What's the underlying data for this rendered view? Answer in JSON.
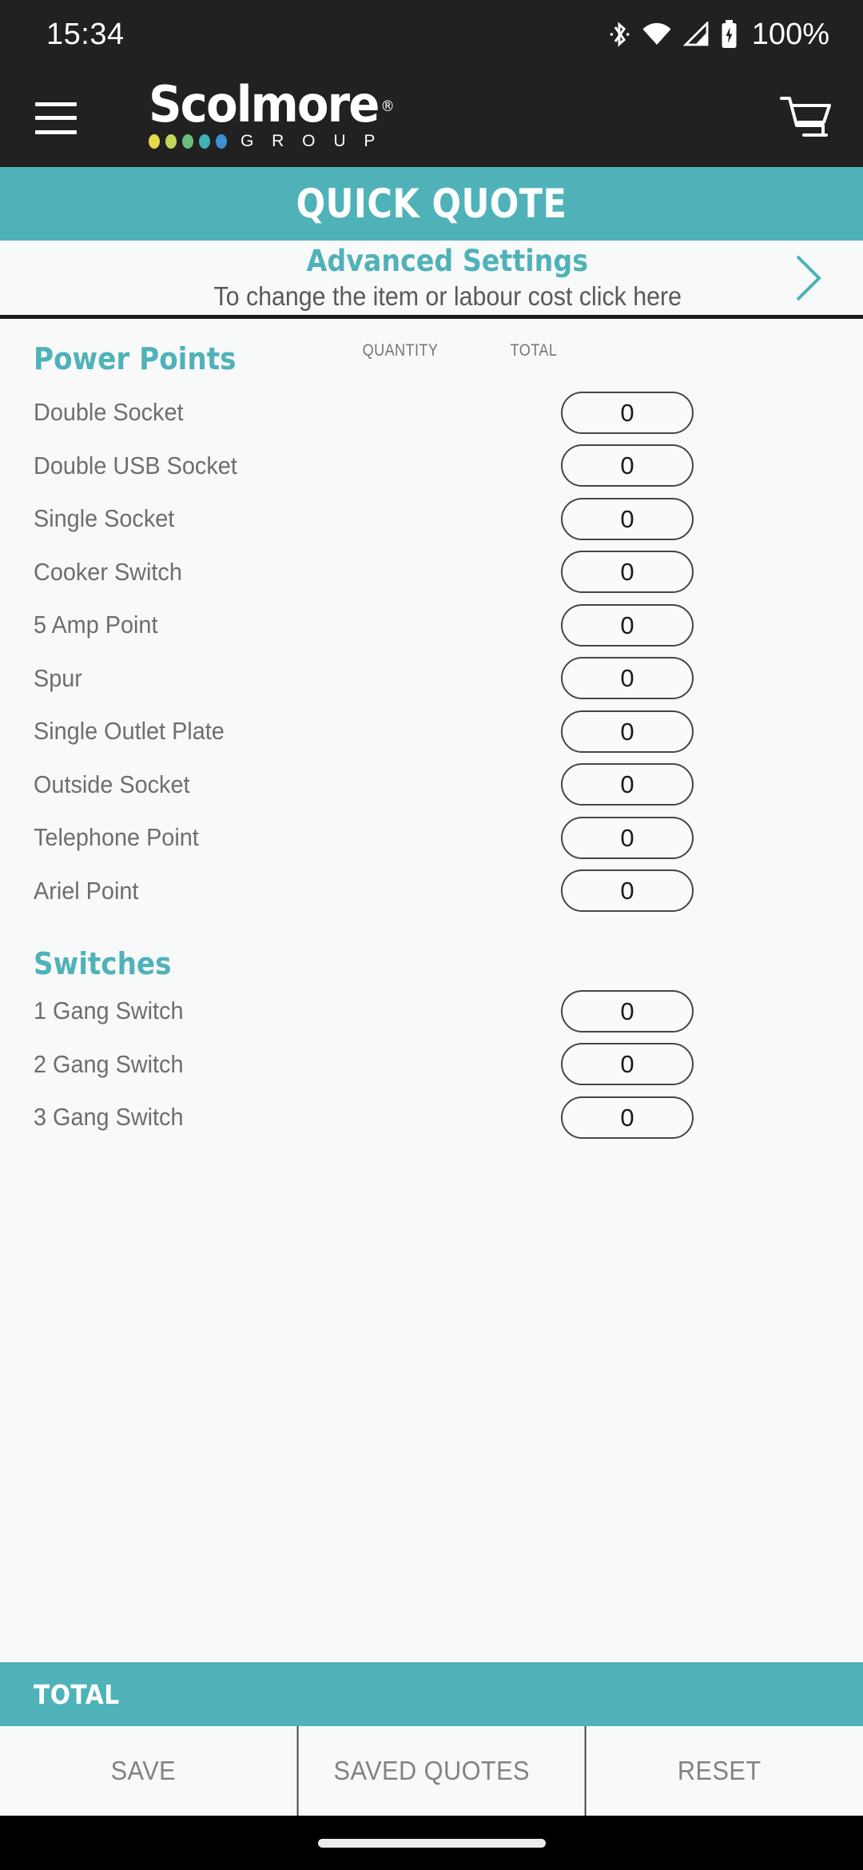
{
  "status_bar": {
    "time": "15:34",
    "battery_percent": "100%",
    "icons": [
      "bluetooth-icon",
      "wifi-icon",
      "cellular-signal-icon",
      "battery-charging-icon"
    ]
  },
  "app_bar": {
    "menu_icon": "hamburger-menu-icon",
    "brand_name": "Scolmore",
    "brand_registered": "®",
    "brand_subtitle": "G R O U P",
    "cart_icon": "shopping-cart-icon",
    "logo_dot_colors": [
      "#e8d94a",
      "#c3d65a",
      "#6cbe7f",
      "#3fb0b5",
      "#3d90d0"
    ]
  },
  "page_banner": {
    "title": "QUICK QUOTE"
  },
  "advanced_settings": {
    "title": "Advanced Settings",
    "subtitle": "To change the item or labour cost click here",
    "chevron_icon": "chevron-right-icon"
  },
  "columns": {
    "quantity": "QUANTITY",
    "total": "TOTAL"
  },
  "sections": [
    {
      "title": "Power Points",
      "items": [
        {
          "label": "Double Socket",
          "quantity": "0",
          "total": ""
        },
        {
          "label": "Double USB Socket",
          "quantity": "0",
          "total": ""
        },
        {
          "label": "Single Socket",
          "quantity": "0",
          "total": ""
        },
        {
          "label": "Cooker Switch",
          "quantity": "0",
          "total": ""
        },
        {
          "label": "5 Amp Point",
          "quantity": "0",
          "total": ""
        },
        {
          "label": "Spur",
          "quantity": "0",
          "total": ""
        },
        {
          "label": "Single Outlet Plate",
          "quantity": "0",
          "total": ""
        },
        {
          "label": "Outside Socket",
          "quantity": "0",
          "total": ""
        },
        {
          "label": "Telephone Point",
          "quantity": "0",
          "total": ""
        },
        {
          "label": "Ariel Point",
          "quantity": "0",
          "total": ""
        }
      ]
    },
    {
      "title": "Switches",
      "items": [
        {
          "label": "1 Gang Switch",
          "quantity": "0",
          "total": ""
        },
        {
          "label": "2 Gang Switch",
          "quantity": "0",
          "total": ""
        },
        {
          "label": "3 Gang Switch",
          "quantity": "0",
          "total": ""
        }
      ]
    }
  ],
  "total_bar": {
    "label": "TOTAL",
    "value": ""
  },
  "actions": [
    {
      "label": "SAVE"
    },
    {
      "label": "SAVED QUOTES"
    },
    {
      "label": "RESET"
    }
  ],
  "theme": {
    "teal": "#4fb2b8",
    "dark_bar": "#212121",
    "page_bg": "#f8f9f9",
    "label_text": "#6e6e6e"
  }
}
